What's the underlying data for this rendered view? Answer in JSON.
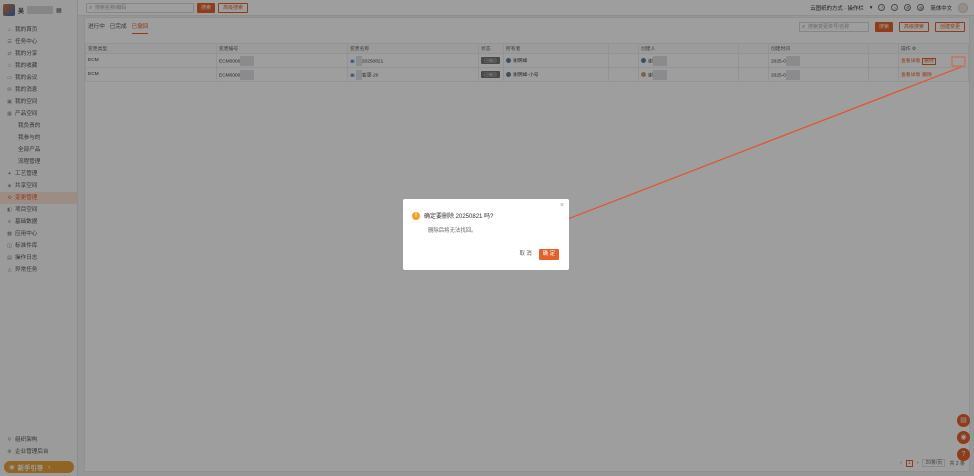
{
  "sidebar": {
    "user_name": "吴",
    "items": [
      {
        "label": "我的首页",
        "icon": "home-icon",
        "active": false,
        "sub": false
      },
      {
        "label": "任务中心",
        "icon": "task-icon",
        "active": false,
        "sub": false
      },
      {
        "label": "我的分享",
        "icon": "share-icon",
        "active": false,
        "sub": false
      },
      {
        "label": "我的收藏",
        "icon": "star-icon",
        "active": false,
        "sub": false
      },
      {
        "label": "我的会议",
        "icon": "meeting-icon",
        "active": false,
        "sub": false
      },
      {
        "label": "我的消息",
        "icon": "message-icon",
        "active": false,
        "sub": false
      },
      {
        "label": "我的空间",
        "icon": "folder-icon",
        "active": false,
        "sub": false
      },
      {
        "label": "产品空间",
        "icon": "box-icon",
        "active": false,
        "sub": false
      },
      {
        "label": "我负责的",
        "icon": "",
        "active": false,
        "sub": true
      },
      {
        "label": "我参与的",
        "icon": "",
        "active": false,
        "sub": true
      },
      {
        "label": "全部产品",
        "icon": "",
        "active": false,
        "sub": true
      },
      {
        "label": "流程管理",
        "icon": "",
        "active": false,
        "sub": true
      },
      {
        "label": "工艺管理",
        "icon": "tool-icon",
        "active": false,
        "sub": false
      },
      {
        "label": "共享空间",
        "icon": "share-space-icon",
        "active": false,
        "sub": false
      },
      {
        "label": "变更管理",
        "icon": "change-icon",
        "active": true,
        "sub": false
      },
      {
        "label": "项目空间",
        "icon": "project-icon",
        "active": false,
        "sub": false
      },
      {
        "label": "基础数据",
        "icon": "database-icon",
        "active": false,
        "sub": false
      },
      {
        "label": "应用中心",
        "icon": "app-icon",
        "active": false,
        "sub": false
      },
      {
        "label": "标准件库",
        "icon": "library-icon",
        "active": false,
        "sub": false
      },
      {
        "label": "操作日志",
        "icon": "log-icon",
        "active": false,
        "sub": false
      },
      {
        "label": "异常任务",
        "icon": "alert-icon",
        "active": false,
        "sub": false
      }
    ],
    "bottom_items": [
      {
        "label": "组织架构",
        "icon": "org-icon"
      },
      {
        "label": "企业管理后台",
        "icon": "admin-icon"
      }
    ],
    "guide_label": "新手引导"
  },
  "topbar": {
    "search_placeholder": "搜索名称/编码",
    "search_button": "搜索",
    "advanced_button": "高级搜索",
    "workspace_label": "云图纸的方式 · 操作栏",
    "language_label": "简体中文"
  },
  "main": {
    "tabs": [
      {
        "label": "进行中",
        "active": false
      },
      {
        "label": "已完成",
        "active": false
      },
      {
        "label": "已撤回",
        "active": true
      }
    ],
    "search_placeholder": "搜索变更单号/名称",
    "search_button": "搜索",
    "advanced_button": "高级搜索",
    "new_button": "创建变更"
  },
  "table": {
    "columns": [
      "变更类型",
      "变更编号",
      "变更名称",
      "状态",
      "所有者",
      "",
      "创建人",
      "",
      "创建时间",
      "",
      "操作"
    ],
    "rows": [
      {
        "type": "ECM",
        "code": "ECM0000",
        "name": "20250821",
        "status": "已撤回",
        "owner": "谢明峰",
        "creator": "谢",
        "created": "2025-0",
        "ops": [
          "查看详情",
          "删除"
        ]
      },
      {
        "type": "ECM",
        "code": "ECM0000",
        "name": "变更-20",
        "status": "已撤回",
        "owner": "谢明峰-小号",
        "creator": "谢",
        "created": "2025-0",
        "ops": [
          "查看详情",
          "删除"
        ]
      }
    ]
  },
  "pager": {
    "current": "1",
    "page_size": "20条/页",
    "total": "共 2 条"
  },
  "dialog": {
    "title": "确定要删除 20250821 吗?",
    "message": "删除后将无法找回。",
    "cancel": "取 消",
    "confirm": "确 定",
    "close": "×"
  },
  "colors": {
    "accent": "#e5612a",
    "warning": "#f0a21b"
  }
}
